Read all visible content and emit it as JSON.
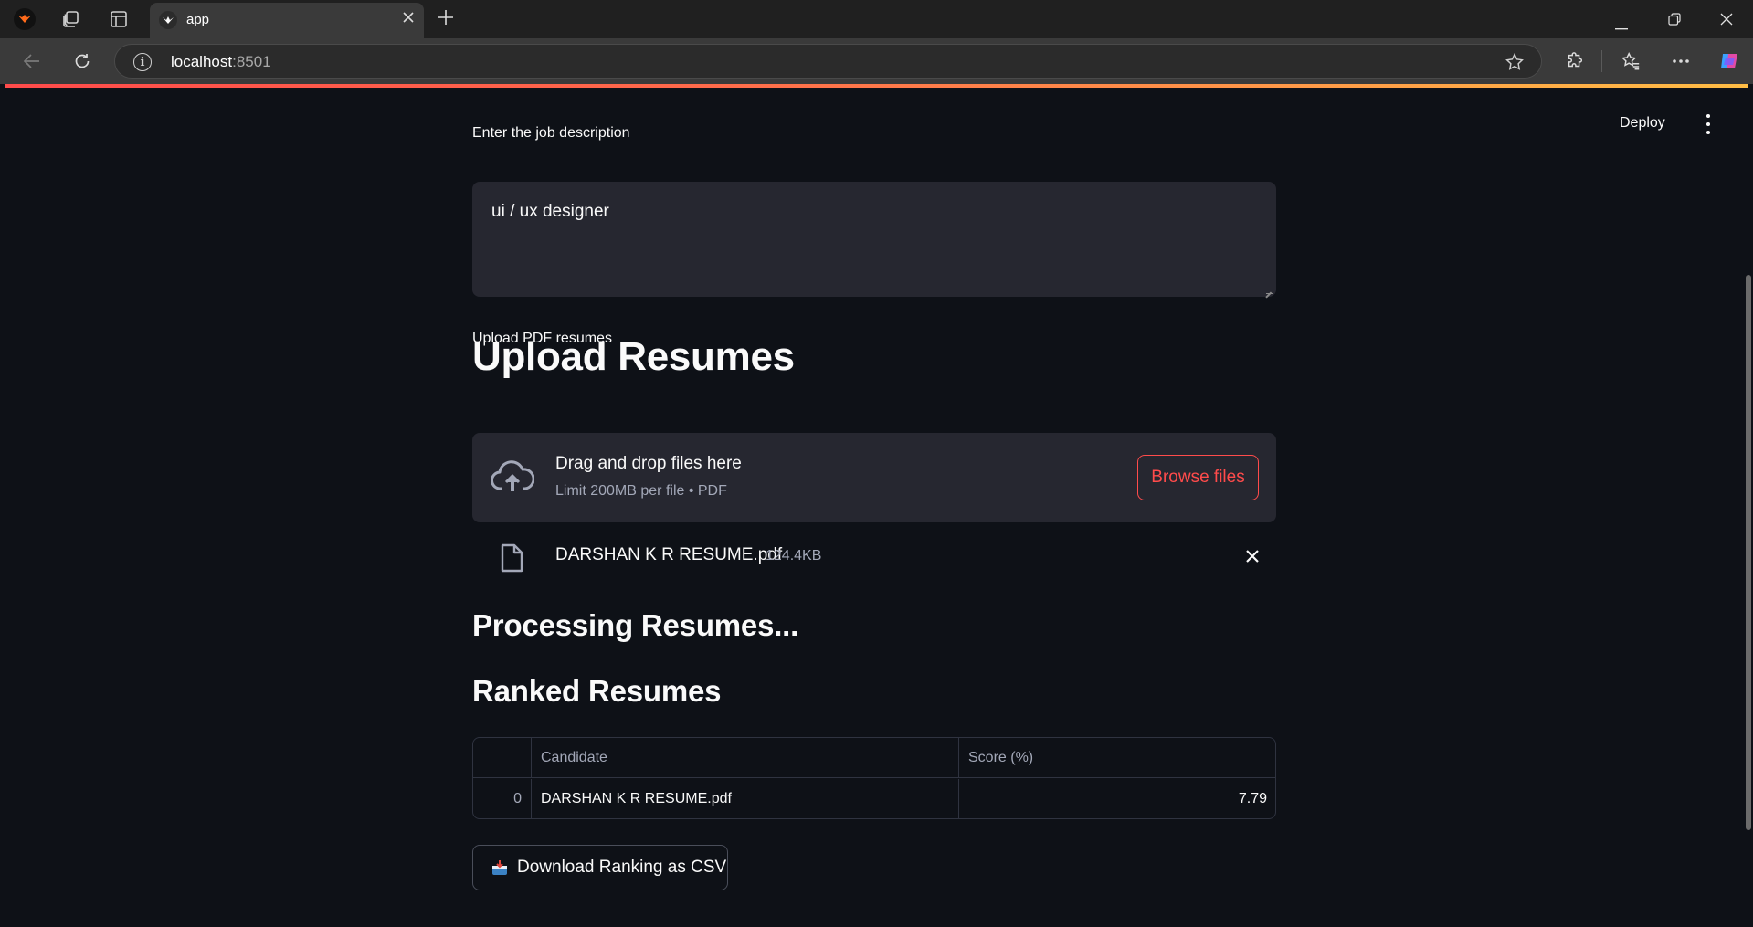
{
  "browser": {
    "tab_title": "app",
    "url_host": "localhost",
    "url_port": ":8501"
  },
  "app": {
    "header": {
      "deploy_label": "Deploy"
    },
    "job_description": {
      "label": "Enter the job description",
      "value": "ui / ux designer"
    },
    "upload_heading": "Upload Resumes",
    "uploader": {
      "label": "Upload PDF resumes",
      "drop_title": "Drag and drop files here",
      "drop_subtitle": "Limit 200MB per file • PDF",
      "browse_label": "Browse files"
    },
    "uploaded_file": {
      "name": "DARSHAN K R RESUME.pdf",
      "size": "124.4KB"
    },
    "processing_heading": "Processing Resumes...",
    "ranked_heading": "Ranked Resumes",
    "table": {
      "columns": [
        "",
        "Candidate",
        "Score (%)"
      ],
      "rows": [
        {
          "index": "0",
          "candidate": "DARSHAN K R RESUME.pdf",
          "score": "7.79"
        }
      ]
    },
    "download_label": "Download Ranking as CSV"
  },
  "colors": {
    "background": "#0e1117",
    "input_bg": "#262730",
    "accent": "#ff4b4b",
    "text": "#fafafa",
    "muted": "#a3a8b8"
  }
}
